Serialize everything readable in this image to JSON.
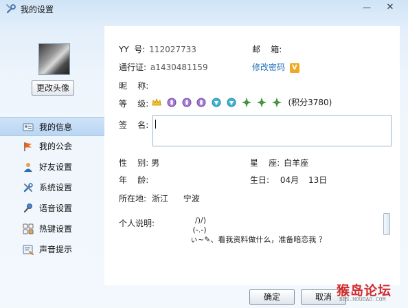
{
  "window": {
    "title": "我的设置",
    "minimize": "—",
    "close": "✕"
  },
  "sidebar": {
    "change_avatar": "更改头像",
    "items": [
      {
        "label": "我的信息",
        "icon": "id-card-icon",
        "active": true
      },
      {
        "label": "我的公会",
        "icon": "flag-icon"
      },
      {
        "label": "好友设置",
        "icon": "person-icon"
      },
      {
        "label": "系统设置",
        "icon": "wrench-icon"
      },
      {
        "label": "语音设置",
        "icon": "microphone-icon"
      },
      {
        "label": "热键设置",
        "icon": "keyboard-icon"
      },
      {
        "label": "声音提示",
        "icon": "notification-icon"
      }
    ]
  },
  "profile": {
    "yy_label": "YY  号:",
    "yy_value": "112027733",
    "email_label": "邮    箱:",
    "email_value": "",
    "passport_label": "通行证:",
    "passport_value": "a1430481159",
    "change_password": "修改密码",
    "vip_badge": "V",
    "nickname_label": "昵    称:",
    "nickname_value": "",
    "level_label": "等    级:",
    "level_score": "(积分3780)",
    "signature_label": "签    名:",
    "gender_label": "性    别:",
    "gender_value": "男",
    "constellation_label": "星    座:",
    "constellation_value": "白羊座",
    "age_label": "年    龄:",
    "age_value": "",
    "birthday_label": "生日:",
    "birthday_month": "04月",
    "birthday_day": "13日",
    "location_label": "所在地:",
    "province": "浙江",
    "city": "宁波",
    "description_label": "个人说明:",
    "description_text": "    /)/)\n   (-.-)\n  ぃ~✎、看我资料做什么，准备暗恋我 ？"
  },
  "footer": {
    "ok": "确定",
    "cancel": "取消"
  },
  "watermark": {
    "text": "猴岛论坛",
    "url": "BBS.HOUDAO.COM"
  },
  "colors": {
    "link": "#1f6fb3",
    "active_nav": "#c3dcf5",
    "watermark": "#d42b2b"
  }
}
